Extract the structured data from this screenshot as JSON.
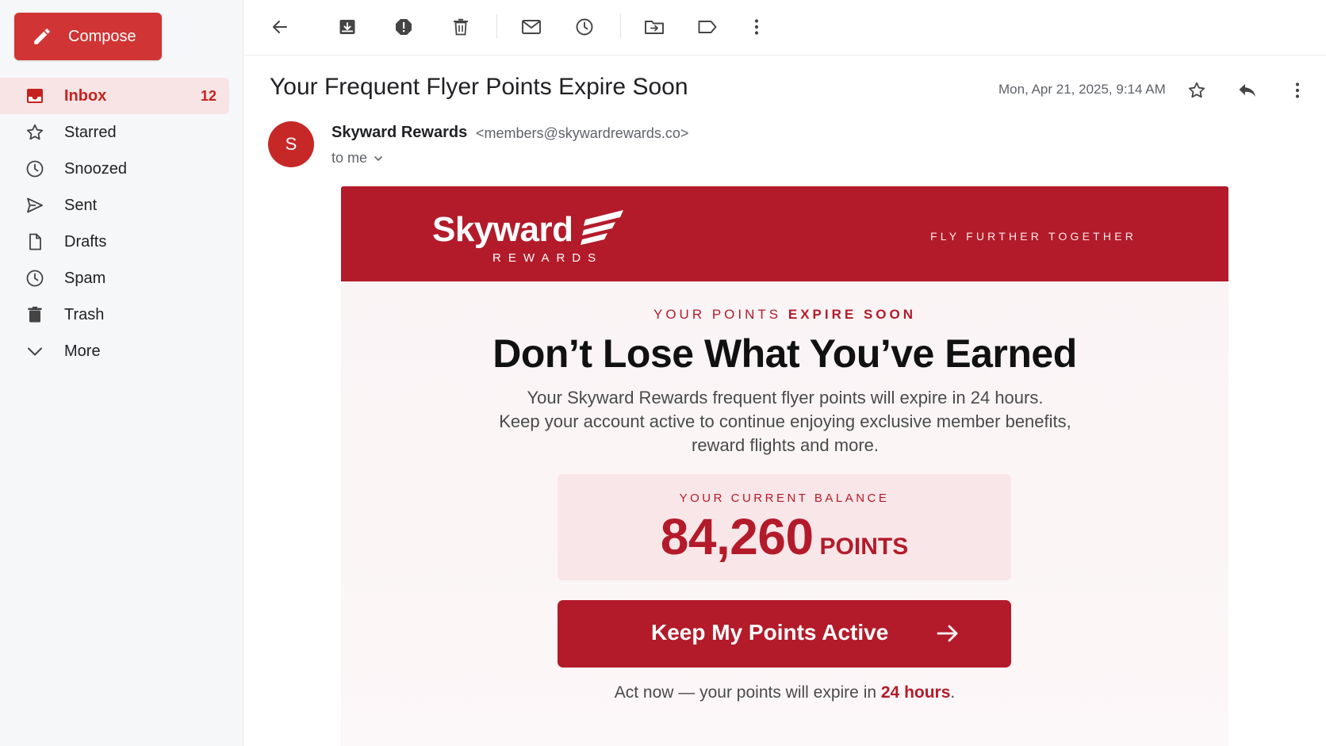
{
  "sidebar": {
    "compose_label": "Compose",
    "items": [
      {
        "label": "Inbox",
        "count": "12",
        "icon": "inbox-icon"
      },
      {
        "label": "Starred",
        "icon": "star-icon"
      },
      {
        "label": "Snoozed",
        "icon": "clock-icon"
      },
      {
        "label": "Sent",
        "icon": "send-icon"
      },
      {
        "label": "Drafts",
        "icon": "file-icon"
      },
      {
        "label": "Spam",
        "icon": "clock-icon"
      },
      {
        "label": "Trash",
        "icon": "trash-icon"
      },
      {
        "label": "More",
        "icon": "chevron-down-icon"
      }
    ]
  },
  "toolbar": {
    "icons": [
      "back-arrow-icon",
      "archive-icon",
      "report-spam-icon",
      "delete-icon",
      "mark-unread-icon",
      "snooze-icon",
      "move-to-icon",
      "label-icon",
      "more-vert-icon"
    ]
  },
  "message": {
    "subject": "Your Frequent Flyer Points Expire Soon",
    "date": "Mon, Apr 21, 2025, 9:14 AM",
    "sender_initial": "S",
    "sender_name": "Skyward Rewards",
    "sender_email": "<members@skywardrewards.co>",
    "recipient": "to me"
  },
  "email": {
    "brand_color": "#b31b2a",
    "logo_word": "Skyward",
    "logo_sub": "REWARDS",
    "tagline": "FLY FURTHER TOGETHER",
    "eyebrow_part1": "YOUR POINTS ",
    "eyebrow_part2": "EXPIRE SOON",
    "headline": "Don’t Lose What You’ve Earned",
    "body_line1": "Your Skyward Rewards frequent flyer points will expire in 24 hours.",
    "body_line2": "Keep your account active to continue enjoying exclusive member benefits,",
    "body_line3": "reward flights and more.",
    "balance_label": "YOUR CURRENT BALANCE",
    "balance_value": "84,260",
    "balance_unit": "POINTS",
    "cta_label": "Keep My Points Active",
    "footnote_part1": "Act now — your points will expire in ",
    "footnote_highlight": "24 hours",
    "footnote_part2": "."
  }
}
